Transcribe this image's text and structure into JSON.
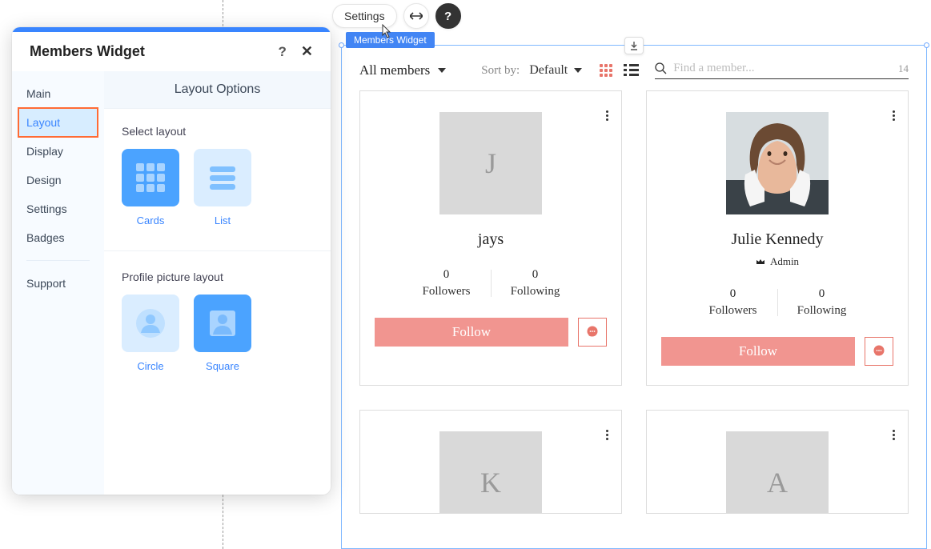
{
  "toolbar": {
    "settings_label": "Settings"
  },
  "widget_badge": "Members Widget",
  "widget": {
    "filter_label": "All members",
    "sort_label": "Sort by:",
    "sort_value": "Default",
    "search_placeholder": "Find a member...",
    "result_count": "14"
  },
  "members": [
    {
      "name": "jays",
      "initial": "J",
      "is_admin": false,
      "followers_num": "0",
      "followers_label": "Followers",
      "following_num": "0",
      "following_label": "Following",
      "follow_label": "Follow"
    },
    {
      "name": "Julie Kennedy",
      "is_admin": true,
      "admin_label": "Admin",
      "followers_num": "0",
      "followers_label": "Followers",
      "following_num": "0",
      "following_label": "Following",
      "follow_label": "Follow"
    },
    {
      "initial": "K"
    },
    {
      "initial": "A"
    }
  ],
  "panel": {
    "title": "Members Widget",
    "nav": {
      "main": "Main",
      "layout": "Layout",
      "display": "Display",
      "design": "Design",
      "settings": "Settings",
      "badges": "Badges",
      "support": "Support"
    },
    "content_title": "Layout Options",
    "section1_label": "Select layout",
    "opts_layout": {
      "cards": "Cards",
      "list": "List"
    },
    "section2_label": "Profile picture layout",
    "opts_pic": {
      "circle": "Circle",
      "square": "Square"
    }
  }
}
